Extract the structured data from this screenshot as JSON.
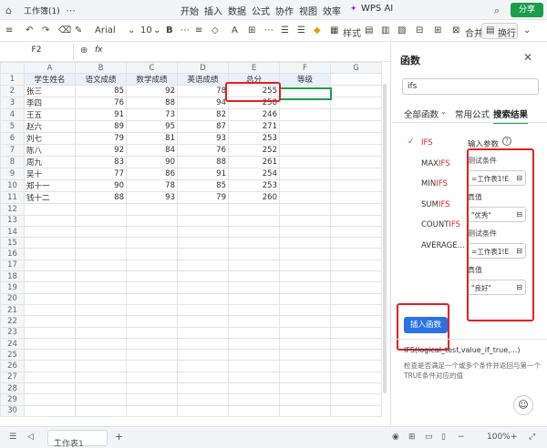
{
  "topbar": {
    "doc_title": "工作簿(1)",
    "tabs": [
      "开始",
      "插入",
      "数据",
      "公式",
      "协作",
      "视图",
      "效率"
    ],
    "active_tab": "开始",
    "wps_ai": "WPS AI",
    "share": "分享"
  },
  "toolbar": {
    "font_name": "Arial",
    "font_size": "10",
    "style_label": "样式",
    "merge_label": "合并",
    "wrap_label": "换行"
  },
  "formula_bar": {
    "cell_ref": "F2",
    "fx": "fx"
  },
  "sheet": {
    "columns": [
      "A",
      "B",
      "C",
      "D",
      "E",
      "F",
      "G"
    ],
    "headers": [
      "学生姓名",
      "语文成绩",
      "数学成绩",
      "英语成绩",
      "总分",
      "等级"
    ],
    "rows": [
      [
        "张三",
        "85",
        "92",
        "78",
        "255",
        ""
      ],
      [
        "李四",
        "76",
        "88",
        "94",
        "258",
        ""
      ],
      [
        "王五",
        "91",
        "73",
        "82",
        "246",
        ""
      ],
      [
        "赵六",
        "89",
        "95",
        "87",
        "271",
        ""
      ],
      [
        "刘七",
        "79",
        "81",
        "93",
        "253",
        ""
      ],
      [
        "陈八",
        "92",
        "84",
        "76",
        "252",
        ""
      ],
      [
        "周九",
        "83",
        "90",
        "88",
        "261",
        ""
      ],
      [
        "吴十",
        "77",
        "86",
        "91",
        "254",
        ""
      ],
      [
        "郑十一",
        "90",
        "78",
        "85",
        "253",
        ""
      ],
      [
        "钱十二",
        "88",
        "93",
        "79",
        "260",
        ""
      ]
    ],
    "row_numbers": [
      "1",
      "2",
      "3",
      "4",
      "5",
      "6",
      "7",
      "8",
      "9",
      "10",
      "11",
      "12",
      "13",
      "14",
      "15",
      "16",
      "17",
      "18",
      "19",
      "20",
      "21",
      "22",
      "23",
      "24",
      "25",
      "26",
      "27",
      "28",
      "29",
      "30"
    ]
  },
  "bottombar": {
    "sheet_tab": "工作表1",
    "zoom": "100%"
  },
  "panel": {
    "title": "函数",
    "search_value": "ifs",
    "tabs": [
      "全部函数",
      "常用公式",
      "搜索结果"
    ],
    "active_tab": "搜索结果",
    "functions": [
      {
        "prefix": "",
        "hi": "IFS",
        "suffix": "",
        "selected": true
      },
      {
        "prefix": "MAX",
        "hi": "IFS",
        "suffix": ""
      },
      {
        "prefix": "MIN",
        "hi": "IFS",
        "suffix": ""
      },
      {
        "prefix": "SUM",
        "hi": "IFS",
        "suffix": ""
      },
      {
        "prefix": "COUNT",
        "hi": "IFS",
        "suffix": ""
      },
      {
        "prefix": "AVERAGE...",
        "hi": "",
        "suffix": ""
      }
    ],
    "param_title": "输入参数",
    "params": [
      {
        "label": "测试条件",
        "value": "=工作表1!E"
      },
      {
        "label": "真值",
        "value": "\"优秀\""
      },
      {
        "label": "测试条件",
        "value": "=工作表1!E"
      },
      {
        "label": "真值",
        "value": "\"良好\""
      }
    ],
    "insert_button": "插入函数",
    "signature": "IFS(logical_test,value_if_true,...)",
    "description": "检查是否满足一个或多个条件并返回与第一个TRUE条件对应的值"
  }
}
